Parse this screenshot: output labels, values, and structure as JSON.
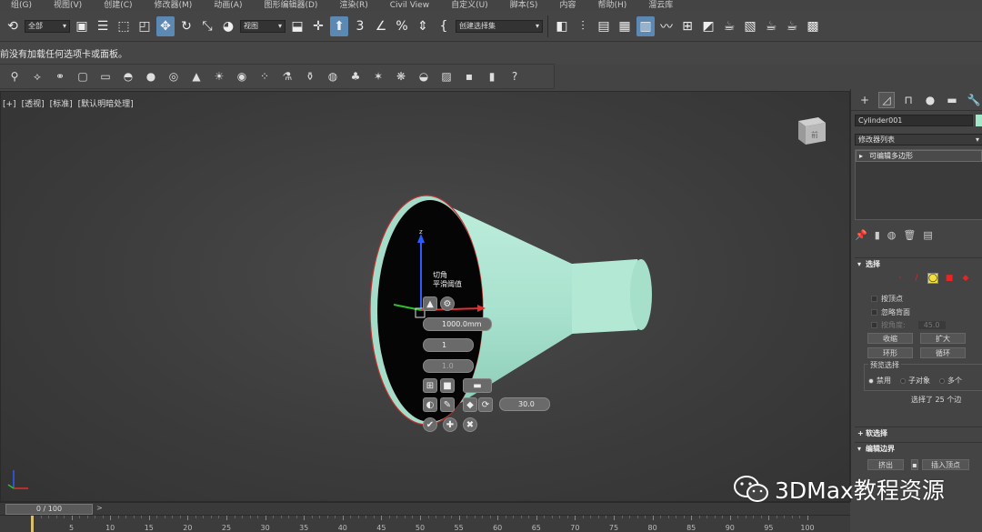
{
  "menu": [
    "组(G)",
    "视图(V)",
    "创建(C)",
    "修改器(M)",
    "动画(A)",
    "图形编辑器(D)",
    "渲染(R)",
    "Civil View",
    "自定义(U)",
    "脚本(S)",
    "内容",
    "帮助(H)",
    "溜云库"
  ],
  "toolbar": {
    "selection_filter": "全部",
    "reference_coord": "视图",
    "named_selection": "创建选择集"
  },
  "status_message": "前没有加载任何选项卡或面板。",
  "viewport": {
    "labels": [
      "[+]",
      "[透视]",
      "[标准]",
      "[默认明暗处理]"
    ],
    "viewcube_face": "前"
  },
  "caddy": {
    "tooltip_line1": "切角",
    "tooltip_line2": "平滑阈值",
    "amount": "1000.0mm",
    "segments": "1",
    "tension": "1.0",
    "angle": "30.0"
  },
  "command_panel": {
    "object_name": "Cylinder001",
    "object_color": "#a0e8c8",
    "modifier_list": "修改器列表",
    "stack_items": [
      "可编辑多边形"
    ],
    "selection_rollout": "选择",
    "by_vertex": "按顶点",
    "ignore_backfacing": "忽略背面",
    "by_angle": "按角度:",
    "by_angle_value": "45.0",
    "shrink": "收缩",
    "grow": "扩大",
    "ring": "环形",
    "loop": "循环",
    "preview_label": "预览选择",
    "preview_options": [
      "禁用",
      "子对象",
      "多个"
    ],
    "selected_count": "选择了 25 个边",
    "soft_selection": "软选择",
    "edit_borders": "编辑边界",
    "extrude": "挤出",
    "insert_vertex": "插入顶点",
    "create_shape": "利用所选内容创建图形"
  },
  "timeline": {
    "frame_display": "0 / 100",
    "arrow": ">",
    "ticks": [
      "5",
      "10",
      "15",
      "20",
      "25",
      "30",
      "35",
      "40",
      "45",
      "50",
      "55",
      "60",
      "65",
      "70",
      "75",
      "80",
      "85",
      "90",
      "95",
      "100"
    ]
  },
  "watermark": {
    "text": "3DMax教程资源"
  }
}
